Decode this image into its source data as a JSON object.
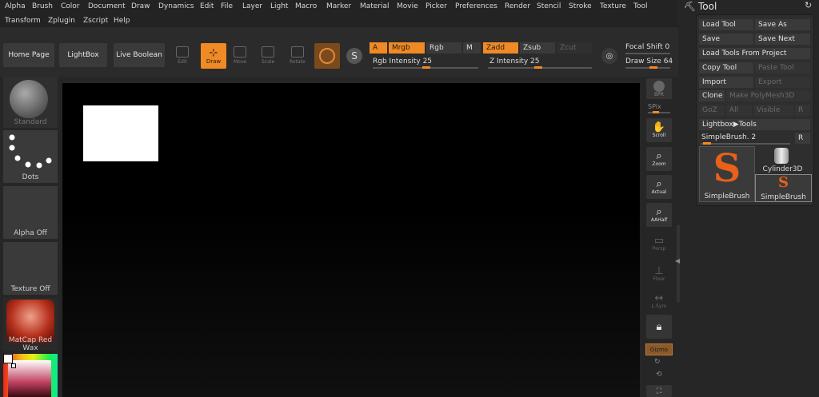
{
  "menu": [
    "Alpha",
    "Brush",
    "Color",
    "Document",
    "Draw",
    "Dynamics",
    "Edit",
    "File",
    "Layer",
    "Light",
    "Macro",
    "Marker",
    "Material",
    "Movie",
    "Picker",
    "Preferences",
    "Render",
    "Stencil",
    "Stroke",
    "Texture",
    "Tool",
    "Transform",
    "Zplugin",
    "Zscript",
    "Help"
  ],
  "top": {
    "home_page": "Home Page",
    "lightbox": "LightBox",
    "live_boolean": "Live Boolean",
    "modes": {
      "edit": "Edit",
      "draw": "Draw",
      "move": "Move",
      "scale": "Scale",
      "rotate": "Rotate"
    },
    "a": "A",
    "mrgb": "Mrgb",
    "rgb": "Rgb",
    "m": "M",
    "zadd": "Zadd",
    "zsub": "Zsub",
    "zcut": "Zcut",
    "rgb_intensity": "Rgb Intensity 25",
    "z_intensity": "Z Intensity 25",
    "focal_shift": "Focal Shift 0",
    "draw_size": "Draw Size 64"
  },
  "left": {
    "standard": "Standard",
    "dots": "Dots",
    "alpha_off": "Alpha Off",
    "texture_off": "Texture Off",
    "matcap": "MatCap Red Wax"
  },
  "right": {
    "bpr": "BPR",
    "spix": "SPix",
    "scroll": "Scroll",
    "zoom": "Zoom",
    "actual": "Actual",
    "aahalf": "AAHalf",
    "persp": "Persp",
    "floor": "Floor",
    "lsym": "L.Sym",
    "gizmo": "Gizmo"
  },
  "tool": {
    "title": "Tool",
    "load_tool": "Load Tool",
    "save_as": "Save As",
    "save": "Save",
    "save_next": "Save Next",
    "load_from_project": "Load Tools From Project",
    "copy_tool": "Copy Tool",
    "paste_tool": "Paste Tool",
    "import": "Import",
    "export": "Export",
    "clone": "Clone",
    "make_polymesh": "Make PolyMesh3D",
    "goz": "GoZ",
    "all": "All",
    "visible": "Visible",
    "r": "R",
    "lightbox_tools": "Lightbox▶Tools",
    "current_tool": "SimpleBrush. 2",
    "thumb_simplebrush": "SimpleBrush",
    "thumb_cylinder": "Cylinder3D",
    "thumb_simplebrush2": "SimpleBrush"
  }
}
